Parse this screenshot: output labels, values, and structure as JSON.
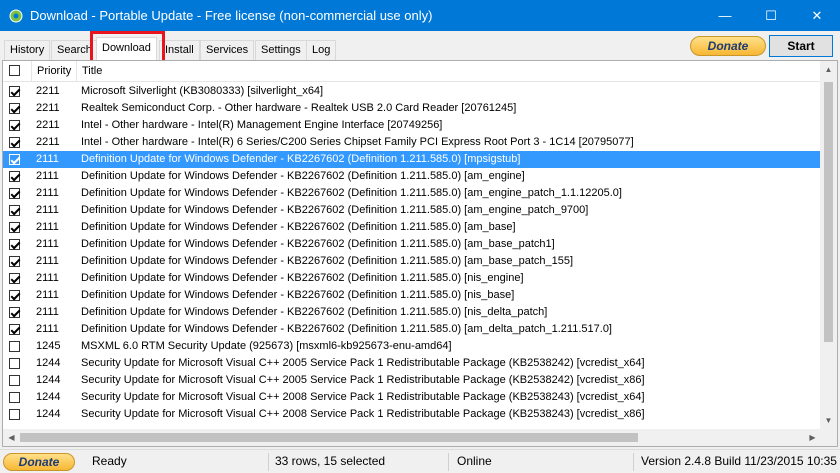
{
  "window": {
    "title": "Download - Portable Update  - Free license (non-commercial use only)",
    "minimize": "—",
    "maximize": "☐",
    "close": "✕"
  },
  "tabs": [
    {
      "label": "History"
    },
    {
      "label": "Search"
    },
    {
      "label": "Download"
    },
    {
      "label": "Install"
    },
    {
      "label": "Services"
    },
    {
      "label": "Settings"
    },
    {
      "label": "Log"
    }
  ],
  "toolbar": {
    "donate_label": "Donate",
    "start_label": "Start"
  },
  "list": {
    "columns": {
      "priority": "Priority",
      "title": "Title"
    },
    "rows": [
      {
        "checked": true,
        "priority": "2211",
        "title": "Microsoft Silverlight (KB3080333) [silverlight_x64]",
        "selected": false
      },
      {
        "checked": true,
        "priority": "2211",
        "title": "Realtek Semiconduct Corp. - Other hardware - Realtek USB 2.0 Card Reader [20761245]",
        "selected": false
      },
      {
        "checked": true,
        "priority": "2211",
        "title": "Intel - Other hardware - Intel(R) Management Engine Interface [20749256]",
        "selected": false
      },
      {
        "checked": true,
        "priority": "2211",
        "title": "Intel - Other hardware - Intel(R) 6 Series/C200 Series Chipset Family PCI Express Root Port 3 - 1C14 [20795077]",
        "selected": false
      },
      {
        "checked": true,
        "priority": "2111",
        "title": "Definition Update for Windows Defender - KB2267602 (Definition 1.211.585.0) [mpsigstub]",
        "selected": true
      },
      {
        "checked": true,
        "priority": "2111",
        "title": "Definition Update for Windows Defender - KB2267602 (Definition 1.211.585.0) [am_engine]",
        "selected": false
      },
      {
        "checked": true,
        "priority": "2111",
        "title": "Definition Update for Windows Defender - KB2267602 (Definition 1.211.585.0) [am_engine_patch_1.1.12205.0]",
        "selected": false
      },
      {
        "checked": true,
        "priority": "2111",
        "title": "Definition Update for Windows Defender - KB2267602 (Definition 1.211.585.0) [am_engine_patch_9700]",
        "selected": false
      },
      {
        "checked": true,
        "priority": "2111",
        "title": "Definition Update for Windows Defender - KB2267602 (Definition 1.211.585.0) [am_base]",
        "selected": false
      },
      {
        "checked": true,
        "priority": "2111",
        "title": "Definition Update for Windows Defender - KB2267602 (Definition 1.211.585.0) [am_base_patch1]",
        "selected": false
      },
      {
        "checked": true,
        "priority": "2111",
        "title": "Definition Update for Windows Defender - KB2267602 (Definition 1.211.585.0) [am_base_patch_155]",
        "selected": false
      },
      {
        "checked": true,
        "priority": "2111",
        "title": "Definition Update for Windows Defender - KB2267602 (Definition 1.211.585.0) [nis_engine]",
        "selected": false
      },
      {
        "checked": true,
        "priority": "2111",
        "title": "Definition Update for Windows Defender - KB2267602 (Definition 1.211.585.0) [nis_base]",
        "selected": false
      },
      {
        "checked": true,
        "priority": "2111",
        "title": "Definition Update for Windows Defender - KB2267602 (Definition 1.211.585.0) [nis_delta_patch]",
        "selected": false
      },
      {
        "checked": true,
        "priority": "2111",
        "title": "Definition Update for Windows Defender - KB2267602 (Definition 1.211.585.0) [am_delta_patch_1.211.517.0]",
        "selected": false
      },
      {
        "checked": false,
        "priority": "1245",
        "title": "MSXML 6.0 RTM Security Update  (925673) [msxml6-kb925673-enu-amd64]",
        "selected": false
      },
      {
        "checked": false,
        "priority": "1244",
        "title": "Security Update for Microsoft Visual C++ 2005 Service Pack 1 Redistributable Package (KB2538242) [vcredist_x64]",
        "selected": false
      },
      {
        "checked": false,
        "priority": "1244",
        "title": "Security Update for Microsoft Visual C++ 2005 Service Pack 1 Redistributable Package (KB2538242) [vcredist_x86]",
        "selected": false
      },
      {
        "checked": false,
        "priority": "1244",
        "title": "Security Update for Microsoft Visual C++ 2008 Service Pack 1 Redistributable Package (KB2538243) [vcredist_x64]",
        "selected": false
      },
      {
        "checked": false,
        "priority": "1244",
        "title": "Security Update for Microsoft Visual C++ 2008 Service Pack 1 Redistributable Package (KB2538243) [vcredist_x86]",
        "selected": false
      }
    ]
  },
  "statusbar": {
    "donate_label": "Donate",
    "state": "Ready",
    "rows_info": "33 rows, 15 selected",
    "connection": "Online",
    "version": "Version 2.4.8 Build 11/23/2015 10:35"
  }
}
